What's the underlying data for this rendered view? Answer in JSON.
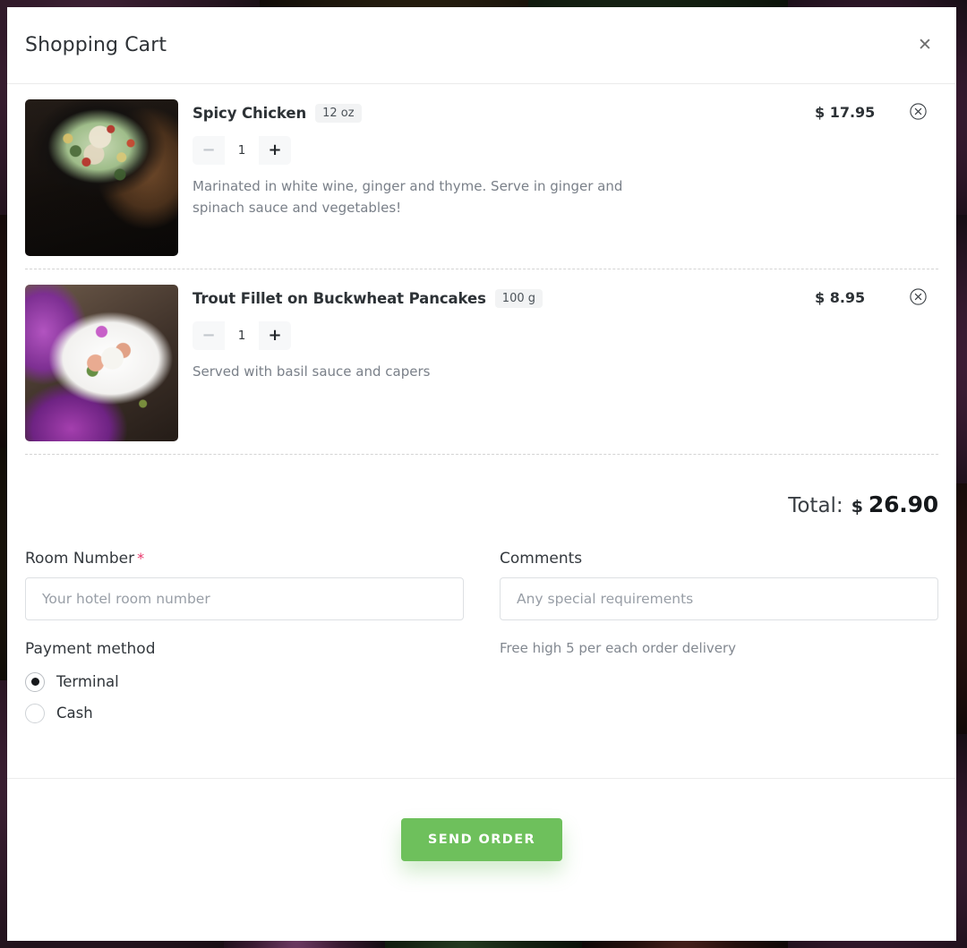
{
  "modal": {
    "title": "Shopping Cart",
    "close_icon": "close-icon"
  },
  "items": [
    {
      "name": "Spicy Chicken",
      "weight": "12 oz",
      "quantity": "1",
      "minus_label": "−",
      "plus_label": "+",
      "description": "Marinated in white wine, ginger and thyme. Serve in ginger and spinach sauce and vegetables!",
      "price": "$ 17.95",
      "image_alt": "spicy-chicken-photo"
    },
    {
      "name": "Trout Fillet on Buckwheat Pancakes",
      "weight": "100 g",
      "quantity": "1",
      "minus_label": "−",
      "plus_label": "+",
      "description": "Served with basil sauce and capers",
      "price": "$ 8.95",
      "image_alt": "trout-fillet-photo"
    }
  ],
  "total": {
    "label": "Total:",
    "currency": "$",
    "amount": "26.90"
  },
  "form": {
    "room_number": {
      "label": "Room Number",
      "required_mark": "*",
      "placeholder": "Your hotel room number",
      "value": ""
    },
    "comments": {
      "label": "Comments",
      "placeholder": "Any special requirements",
      "value": ""
    },
    "payment": {
      "title": "Payment method",
      "options": [
        {
          "label": "Terminal",
          "selected": true
        },
        {
          "label": "Cash",
          "selected": false
        }
      ]
    },
    "delivery_note": "Free high 5 per each order delivery"
  },
  "footer": {
    "send_label": "SEND ORDER"
  },
  "colors": {
    "accent_green": "#6ec05c",
    "required_pink": "#e8366b",
    "text_dark": "#2d3236",
    "text_muted": "#7a8089"
  }
}
